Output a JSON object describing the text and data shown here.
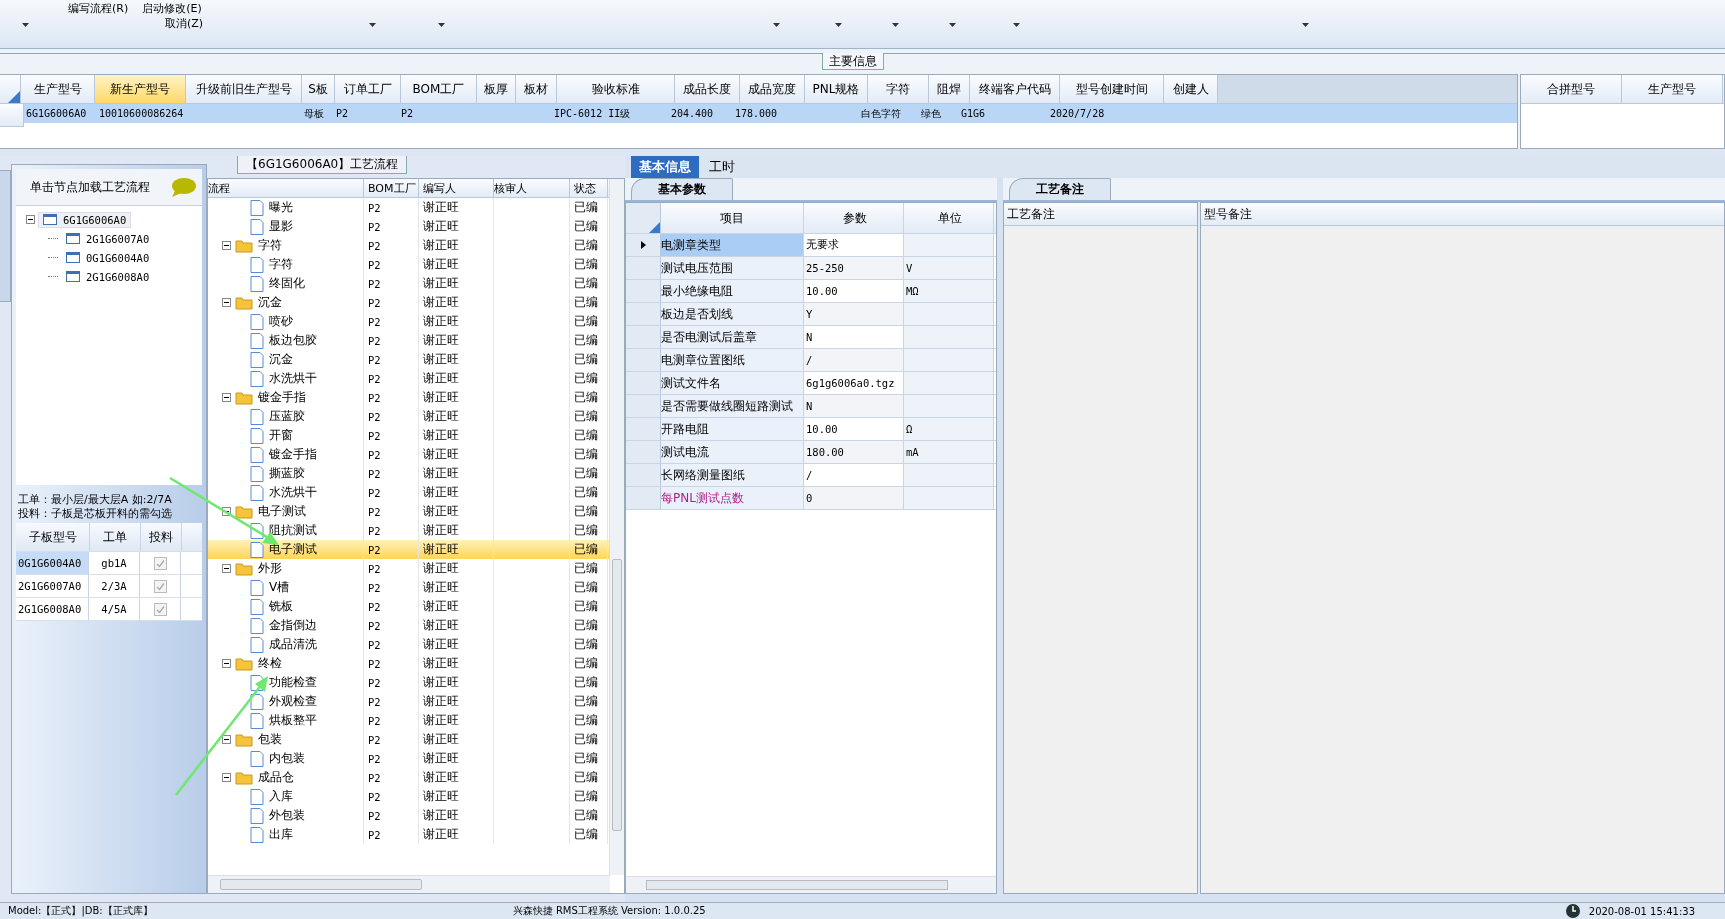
{
  "ribbon": {
    "menu": [
      {
        "label": "编写流程(R)"
      },
      {
        "label": "启动修改(E)"
      },
      {
        "label": "取消(Z)"
      }
    ]
  },
  "main_info": {
    "title": "主要信息",
    "columns": [
      {
        "label": "生产型号",
        "selected": false,
        "value": "6G1G6006A0"
      },
      {
        "label": "新生产型号",
        "selected": true,
        "value": "10010600086264"
      },
      {
        "label": "升级前旧生产型号",
        "selected": false
      },
      {
        "label": "S板",
        "selected": false,
        "value": "母板"
      },
      {
        "label": "订单工厂",
        "selected": false,
        "value": "P2"
      },
      {
        "label": "BOM工厂",
        "selected": false,
        "value": "P2"
      },
      {
        "label": "板厚",
        "selected": false
      },
      {
        "label": "板材",
        "selected": false
      },
      {
        "label": "验收标准",
        "selected": false,
        "value": "IPC-6012 II级"
      },
      {
        "label": "成品长度",
        "selected": false,
        "value": "204.400"
      },
      {
        "label": "成品宽度",
        "selected": false,
        "value": "178.000"
      },
      {
        "label": "PNL规格",
        "selected": false
      },
      {
        "label": "字符",
        "selected": false,
        "value": "白色字符"
      },
      {
        "label": "阻焊",
        "selected": false,
        "value": "绿色"
      },
      {
        "label": "终端客户代码",
        "selected": false,
        "value": "G1G6"
      },
      {
        "label": "型号创建时间",
        "selected": false,
        "value": "2020/7/28"
      },
      {
        "label": "创建人",
        "selected": false
      }
    ],
    "row_selected": true,
    "merge_columns": [
      "合拼型号",
      "生产型号"
    ]
  },
  "node_panel": {
    "hint": "单击节点加载工艺流程",
    "tree": [
      {
        "label": "6G1G6006A0",
        "expanded": true,
        "selected": true,
        "children": [
          {
            "label": "2G1G6007A0",
            "selected": false
          },
          {
            "label": "0G1G6004A0",
            "selected": false
          },
          {
            "label": "2G1G6008A0",
            "selected": false
          }
        ]
      }
    ],
    "notes": [
      "工单：最小层/最大层A 如:2/7A",
      "投料：子板是芯板开料的需勾选"
    ],
    "sub_grid": {
      "columns": [
        "子板型号",
        "工单",
        "投料"
      ],
      "rows": [
        {
          "model": "0G1G6004A0",
          "order": "gb1A",
          "checked": true,
          "selected": true
        },
        {
          "model": "2G1G6007A0",
          "order": "2/3A",
          "checked": true,
          "selected": false
        },
        {
          "model": "2G1G6008A0",
          "order": "4/5A",
          "checked": true,
          "selected": false
        }
      ]
    }
  },
  "flow_panel": {
    "title": "【6G1G6006A0】工艺流程",
    "columns": [
      "流程",
      "BOM工厂",
      "编写人",
      "核审人",
      "状态"
    ],
    "tree": [
      {
        "children": [
          {
            "label": "曝光",
            "bom": "P2",
            "writer": "谢正旺",
            "status": "已编",
            "selected": false
          },
          {
            "label": "显影",
            "bom": "P2",
            "writer": "谢正旺",
            "status": "已编",
            "selected": false
          }
        ]
      },
      {
        "label": "字符",
        "bom": "P2",
        "writer": "谢正旺",
        "status": "已编",
        "expanded": true,
        "selected": false,
        "children": [
          {
            "label": "字符",
            "bom": "P2",
            "writer": "谢正旺",
            "status": "已编",
            "selected": false
          },
          {
            "label": "终固化",
            "bom": "P2",
            "writer": "谢正旺",
            "status": "已编",
            "selected": false
          }
        ]
      },
      {
        "label": "沉金",
        "bom": "P2",
        "writer": "谢正旺",
        "status": "已编",
        "expanded": true,
        "selected": false,
        "children": [
          {
            "label": "喷砂",
            "bom": "P2",
            "writer": "谢正旺",
            "status": "已编",
            "selected": false
          },
          {
            "label": "板边包胶",
            "bom": "P2",
            "writer": "谢正旺",
            "status": "已编",
            "selected": false
          },
          {
            "label": "沉金",
            "bom": "P2",
            "writer": "谢正旺",
            "status": "已编",
            "selected": false
          },
          {
            "label": "水洗烘干",
            "bom": "P2",
            "writer": "谢正旺",
            "status": "已编",
            "selected": false
          }
        ]
      },
      {
        "label": "镀金手指",
        "bom": "P2",
        "writer": "谢正旺",
        "status": "已编",
        "expanded": true,
        "selected": false,
        "children": [
          {
            "label": "压蓝胶",
            "bom": "P2",
            "writer": "谢正旺",
            "status": "已编",
            "selected": false
          },
          {
            "label": "开窗",
            "bom": "P2",
            "writer": "谢正旺",
            "status": "已编",
            "selected": false
          },
          {
            "label": "镀金手指",
            "bom": "P2",
            "writer": "谢正旺",
            "status": "已编",
            "selected": false
          },
          {
            "label": "撕蓝胶",
            "bom": "P2",
            "writer": "谢正旺",
            "status": "已编",
            "selected": false
          },
          {
            "label": "水洗烘干",
            "bom": "P2",
            "writer": "谢正旺",
            "status": "已编",
            "selected": false
          }
        ]
      },
      {
        "label": "电子测试",
        "bom": "P2",
        "writer": "谢正旺",
        "status": "已编",
        "expanded": true,
        "selected": false,
        "children": [
          {
            "label": "阻抗测试",
            "bom": "P2",
            "writer": "谢正旺",
            "status": "已编",
            "selected": false
          },
          {
            "label": "电子测试",
            "bom": "P2",
            "writer": "谢正旺",
            "status": "已编",
            "selected": true
          }
        ]
      },
      {
        "label": "外形",
        "bom": "P2",
        "writer": "谢正旺",
        "status": "已编",
        "expanded": true,
        "selected": false,
        "children": [
          {
            "label": "V槽",
            "bom": "P2",
            "writer": "谢正旺",
            "status": "已编",
            "selected": false
          },
          {
            "label": "铣板",
            "bom": "P2",
            "writer": "谢正旺",
            "status": "已编",
            "selected": false
          },
          {
            "label": "金指倒边",
            "bom": "P2",
            "writer": "谢正旺",
            "status": "已编",
            "selected": false
          },
          {
            "label": "成品清洗",
            "bom": "P2",
            "writer": "谢正旺",
            "status": "已编",
            "selected": false
          }
        ]
      },
      {
        "label": "终检",
        "bom": "P2",
        "writer": "谢正旺",
        "status": "已编",
        "expanded": true,
        "selected": false,
        "children": [
          {
            "label": "功能检查",
            "bom": "P2",
            "writer": "谢正旺",
            "status": "已编",
            "selected": false
          },
          {
            "label": "外观检查",
            "bom": "P2",
            "writer": "谢正旺",
            "status": "已编",
            "selected": false
          },
          {
            "label": "烘板整平",
            "bom": "P2",
            "writer": "谢正旺",
            "status": "已编",
            "selected": false
          }
        ]
      },
      {
        "label": "包装",
        "bom": "P2",
        "writer": "谢正旺",
        "status": "已编",
        "expanded": true,
        "selected": false,
        "children": [
          {
            "label": "内包装",
            "bom": "P2",
            "writer": "谢正旺",
            "status": "已编",
            "selected": false
          }
        ]
      },
      {
        "label": "成品仓",
        "bom": "P2",
        "writer": "谢正旺",
        "status": "已编",
        "expanded": true,
        "selected": false,
        "children": [
          {
            "label": "入库",
            "bom": "P2",
            "writer": "谢正旺",
            "status": "已编",
            "selected": false
          },
          {
            "label": "外包装",
            "bom": "P2",
            "writer": "谢正旺",
            "status": "已编",
            "selected": false
          },
          {
            "label": "出库",
            "bom": "P2",
            "writer": "谢正旺",
            "status": "已编",
            "selected": false
          }
        ]
      }
    ]
  },
  "tabs": [
    {
      "label": "基本信息",
      "selected": true
    },
    {
      "label": "工时",
      "selected": false
    }
  ],
  "params": {
    "tab": "基本参数",
    "columns": [
      "项目",
      "参数",
      "单位"
    ],
    "rows": [
      {
        "item": "电测章类型",
        "value": "无要求",
        "selected": true
      },
      {
        "item": "测试电压范围",
        "value": "25-250",
        "unit": "V",
        "selected": false
      },
      {
        "item": "最小绝缘电阻",
        "value": "10.00",
        "unit": "MΩ",
        "selected": false
      },
      {
        "item": "板边是否划线",
        "value": "Y",
        "selected": false
      },
      {
        "item": "是否电测试后盖章",
        "value": "N",
        "selected": false
      },
      {
        "item": "电测章位置图纸",
        "value": "/",
        "selected": false
      },
      {
        "item": "测试文件名",
        "value": "6g1g6006a0.tgz",
        "selected": false
      },
      {
        "item": "是否需要做线圈短路测试",
        "value": "N",
        "selected": false
      },
      {
        "item": "开路电阻",
        "value": "10.00",
        "unit": "Ω",
        "selected": false
      },
      {
        "item": "测试电流",
        "value": "180.00",
        "unit": "mA",
        "selected": false
      },
      {
        "item": "长网络测量图纸",
        "value": "/",
        "selected": false
      },
      {
        "item": "每PNL测试点数",
        "value": "0",
        "color": "#b0208a",
        "selected": false
      }
    ]
  },
  "remarks": {
    "tab": "工艺备注",
    "columns": [
      "工艺备注",
      "型号备注"
    ]
  },
  "status_bar": {
    "left": "Model:【正式】|DB:【正式库】",
    "center": "兴森快捷 RMS工程系统 Version: 1.0.0.25",
    "time": "2020-08-01 15:41:33"
  }
}
